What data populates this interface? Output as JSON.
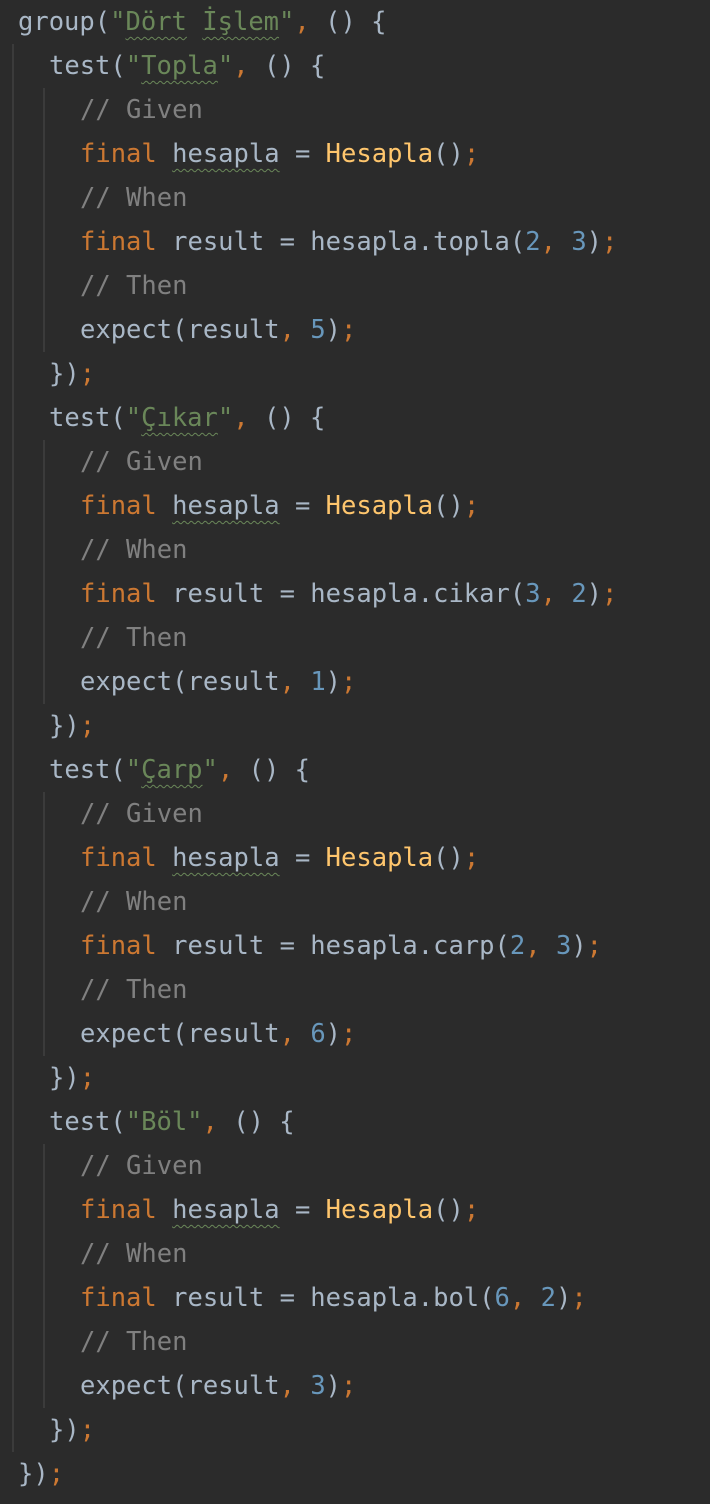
{
  "editor": {
    "language": "dart",
    "colors": {
      "background": "#2b2b2b",
      "default": "#a9b7c6",
      "string": "#6a8759",
      "comment": "#808080",
      "keyword": "#cc7832",
      "class": "#ffc66d",
      "number": "#6897bb"
    },
    "lines": [
      {
        "indent": 0,
        "tokens": [
          {
            "t": "group(",
            "c": "default"
          },
          {
            "t": "\"",
            "c": "string"
          },
          {
            "t": "Dört",
            "c": "string",
            "sq": true
          },
          {
            "t": " ",
            "c": "string"
          },
          {
            "t": "İşlem",
            "c": "string",
            "sq": true
          },
          {
            "t": "\"",
            "c": "string"
          },
          {
            "t": ",",
            "c": "punct"
          },
          {
            "t": " () {",
            "c": "default"
          }
        ]
      },
      {
        "indent": 1,
        "tokens": [
          {
            "t": "test(",
            "c": "default"
          },
          {
            "t": "\"",
            "c": "string"
          },
          {
            "t": "Topla",
            "c": "string",
            "sq": true
          },
          {
            "t": "\"",
            "c": "string"
          },
          {
            "t": ",",
            "c": "punct"
          },
          {
            "t": " () {",
            "c": "default"
          }
        ]
      },
      {
        "indent": 2,
        "tokens": [
          {
            "t": "// Given",
            "c": "comment"
          }
        ]
      },
      {
        "indent": 2,
        "tokens": [
          {
            "t": "final",
            "c": "keyword"
          },
          {
            "t": " ",
            "c": "default"
          },
          {
            "t": "hesapla",
            "c": "default",
            "sq": true
          },
          {
            "t": " = ",
            "c": "default"
          },
          {
            "t": "Hesapla",
            "c": "class"
          },
          {
            "t": "()",
            "c": "default"
          },
          {
            "t": ";",
            "c": "punct"
          }
        ]
      },
      {
        "indent": 2,
        "tokens": [
          {
            "t": "// When",
            "c": "comment"
          }
        ]
      },
      {
        "indent": 2,
        "tokens": [
          {
            "t": "final",
            "c": "keyword"
          },
          {
            "t": " result = hesapla.topla(",
            "c": "default"
          },
          {
            "t": "2",
            "c": "number"
          },
          {
            "t": ",",
            "c": "punct"
          },
          {
            "t": " ",
            "c": "default"
          },
          {
            "t": "3",
            "c": "number"
          },
          {
            "t": ")",
            "c": "default"
          },
          {
            "t": ";",
            "c": "punct"
          }
        ]
      },
      {
        "indent": 2,
        "tokens": [
          {
            "t": "// Then",
            "c": "comment"
          }
        ]
      },
      {
        "indent": 2,
        "tokens": [
          {
            "t": "expect(result",
            "c": "default"
          },
          {
            "t": ",",
            "c": "punct"
          },
          {
            "t": " ",
            "c": "default"
          },
          {
            "t": "5",
            "c": "number"
          },
          {
            "t": ")",
            "c": "default"
          },
          {
            "t": ";",
            "c": "punct"
          }
        ]
      },
      {
        "indent": 1,
        "tokens": [
          {
            "t": "})",
            "c": "default"
          },
          {
            "t": ";",
            "c": "punct"
          }
        ]
      },
      {
        "indent": 1,
        "tokens": [
          {
            "t": "test(",
            "c": "default"
          },
          {
            "t": "\"",
            "c": "string"
          },
          {
            "t": "Çıkar",
            "c": "string",
            "sq": true
          },
          {
            "t": "\"",
            "c": "string"
          },
          {
            "t": ",",
            "c": "punct"
          },
          {
            "t": " () {",
            "c": "default"
          }
        ]
      },
      {
        "indent": 2,
        "tokens": [
          {
            "t": "// Given",
            "c": "comment"
          }
        ]
      },
      {
        "indent": 2,
        "tokens": [
          {
            "t": "final",
            "c": "keyword"
          },
          {
            "t": " ",
            "c": "default"
          },
          {
            "t": "hesapla",
            "c": "default",
            "sq": true
          },
          {
            "t": " = ",
            "c": "default"
          },
          {
            "t": "Hesapla",
            "c": "class"
          },
          {
            "t": "()",
            "c": "default"
          },
          {
            "t": ";",
            "c": "punct"
          }
        ]
      },
      {
        "indent": 2,
        "tokens": [
          {
            "t": "// When",
            "c": "comment"
          }
        ]
      },
      {
        "indent": 2,
        "tokens": [
          {
            "t": "final",
            "c": "keyword"
          },
          {
            "t": " result = hesapla.cikar(",
            "c": "default"
          },
          {
            "t": "3",
            "c": "number"
          },
          {
            "t": ",",
            "c": "punct"
          },
          {
            "t": " ",
            "c": "default"
          },
          {
            "t": "2",
            "c": "number"
          },
          {
            "t": ")",
            "c": "default"
          },
          {
            "t": ";",
            "c": "punct"
          }
        ]
      },
      {
        "indent": 2,
        "tokens": [
          {
            "t": "// Then",
            "c": "comment"
          }
        ]
      },
      {
        "indent": 2,
        "tokens": [
          {
            "t": "expect(result",
            "c": "default"
          },
          {
            "t": ",",
            "c": "punct"
          },
          {
            "t": " ",
            "c": "default"
          },
          {
            "t": "1",
            "c": "number"
          },
          {
            "t": ")",
            "c": "default"
          },
          {
            "t": ";",
            "c": "punct"
          }
        ]
      },
      {
        "indent": 1,
        "tokens": [
          {
            "t": "})",
            "c": "default"
          },
          {
            "t": ";",
            "c": "punct"
          }
        ]
      },
      {
        "indent": 1,
        "tokens": [
          {
            "t": "test(",
            "c": "default"
          },
          {
            "t": "\"",
            "c": "string"
          },
          {
            "t": "Çarp",
            "c": "string",
            "sq": true
          },
          {
            "t": "\"",
            "c": "string"
          },
          {
            "t": ",",
            "c": "punct"
          },
          {
            "t": " () {",
            "c": "default"
          }
        ]
      },
      {
        "indent": 2,
        "tokens": [
          {
            "t": "// Given",
            "c": "comment"
          }
        ]
      },
      {
        "indent": 2,
        "tokens": [
          {
            "t": "final",
            "c": "keyword"
          },
          {
            "t": " ",
            "c": "default"
          },
          {
            "t": "hesapla",
            "c": "default",
            "sq": true
          },
          {
            "t": " = ",
            "c": "default"
          },
          {
            "t": "Hesapla",
            "c": "class"
          },
          {
            "t": "()",
            "c": "default"
          },
          {
            "t": ";",
            "c": "punct"
          }
        ]
      },
      {
        "indent": 2,
        "tokens": [
          {
            "t": "// When",
            "c": "comment"
          }
        ]
      },
      {
        "indent": 2,
        "tokens": [
          {
            "t": "final",
            "c": "keyword"
          },
          {
            "t": " result = hesapla.carp(",
            "c": "default"
          },
          {
            "t": "2",
            "c": "number"
          },
          {
            "t": ",",
            "c": "punct"
          },
          {
            "t": " ",
            "c": "default"
          },
          {
            "t": "3",
            "c": "number"
          },
          {
            "t": ")",
            "c": "default"
          },
          {
            "t": ";",
            "c": "punct"
          }
        ]
      },
      {
        "indent": 2,
        "tokens": [
          {
            "t": "// Then",
            "c": "comment"
          }
        ]
      },
      {
        "indent": 2,
        "tokens": [
          {
            "t": "expect(result",
            "c": "default"
          },
          {
            "t": ",",
            "c": "punct"
          },
          {
            "t": " ",
            "c": "default"
          },
          {
            "t": "6",
            "c": "number"
          },
          {
            "t": ")",
            "c": "default"
          },
          {
            "t": ";",
            "c": "punct"
          }
        ]
      },
      {
        "indent": 1,
        "tokens": [
          {
            "t": "})",
            "c": "default"
          },
          {
            "t": ";",
            "c": "punct"
          }
        ]
      },
      {
        "indent": 1,
        "tokens": [
          {
            "t": "test(",
            "c": "default"
          },
          {
            "t": "\"Böl\"",
            "c": "string"
          },
          {
            "t": ",",
            "c": "punct"
          },
          {
            "t": " () {",
            "c": "default"
          }
        ]
      },
      {
        "indent": 2,
        "tokens": [
          {
            "t": "// Given",
            "c": "comment"
          }
        ]
      },
      {
        "indent": 2,
        "tokens": [
          {
            "t": "final",
            "c": "keyword"
          },
          {
            "t": " ",
            "c": "default"
          },
          {
            "t": "hesapla",
            "c": "default",
            "sq": true
          },
          {
            "t": " = ",
            "c": "default"
          },
          {
            "t": "Hesapla",
            "c": "class"
          },
          {
            "t": "()",
            "c": "default"
          },
          {
            "t": ";",
            "c": "punct"
          }
        ]
      },
      {
        "indent": 2,
        "tokens": [
          {
            "t": "// When",
            "c": "comment"
          }
        ]
      },
      {
        "indent": 2,
        "tokens": [
          {
            "t": "final",
            "c": "keyword"
          },
          {
            "t": " result = hesapla.bol(",
            "c": "default"
          },
          {
            "t": "6",
            "c": "number"
          },
          {
            "t": ",",
            "c": "punct"
          },
          {
            "t": " ",
            "c": "default"
          },
          {
            "t": "2",
            "c": "number"
          },
          {
            "t": ")",
            "c": "default"
          },
          {
            "t": ";",
            "c": "punct"
          }
        ]
      },
      {
        "indent": 2,
        "tokens": [
          {
            "t": "// Then",
            "c": "comment"
          }
        ]
      },
      {
        "indent": 2,
        "tokens": [
          {
            "t": "expect(result",
            "c": "default"
          },
          {
            "t": ",",
            "c": "punct"
          },
          {
            "t": " ",
            "c": "default"
          },
          {
            "t": "3",
            "c": "number"
          },
          {
            "t": ")",
            "c": "default"
          },
          {
            "t": ";",
            "c": "punct"
          }
        ]
      },
      {
        "indent": 1,
        "tokens": [
          {
            "t": "})",
            "c": "default"
          },
          {
            "t": ";",
            "c": "punct"
          }
        ]
      },
      {
        "indent": 0,
        "tokens": [
          {
            "t": "})",
            "c": "default"
          },
          {
            "t": ";",
            "c": "punct"
          }
        ]
      }
    ]
  }
}
